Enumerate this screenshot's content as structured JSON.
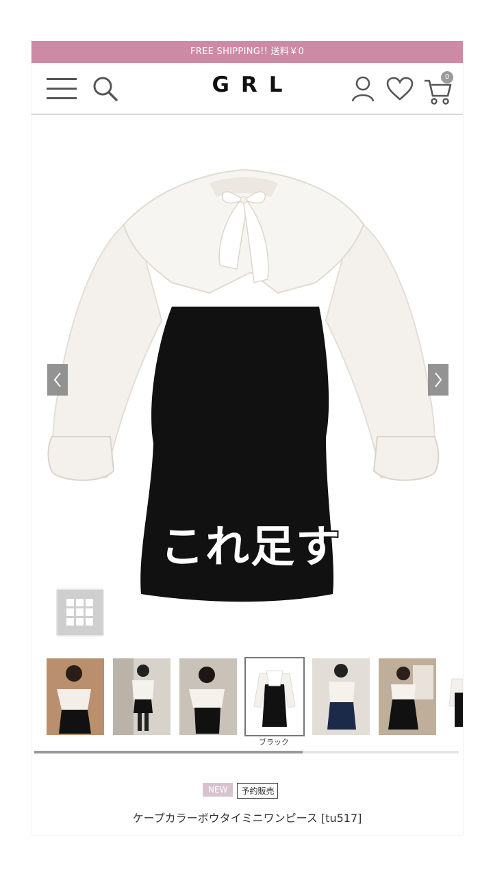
{
  "promo": {
    "text": "FREE SHIPPING!! 送料￥0"
  },
  "header": {
    "logo": "GRL",
    "cart_count": "0",
    "icons": [
      "menu-icon",
      "search-icon",
      "account-icon",
      "heart-icon",
      "cart-icon"
    ]
  },
  "hero": {
    "overlay_text": "これ足す",
    "prev_icon": "chevron-left-icon",
    "next_icon": "chevron-right-icon",
    "grid_icon": "grid-icon"
  },
  "thumbnails": {
    "selected_label": "ブラック",
    "count": 7
  },
  "product": {
    "badge_new": "NEW",
    "badge_preorder": "予約販売",
    "title": "ケープカラーボウタイミニワンピース [tu517]"
  },
  "colors": {
    "promo_bg": "#cc8aa5",
    "dress_black": "#111111",
    "blouse_white": "#f4f1ec"
  }
}
